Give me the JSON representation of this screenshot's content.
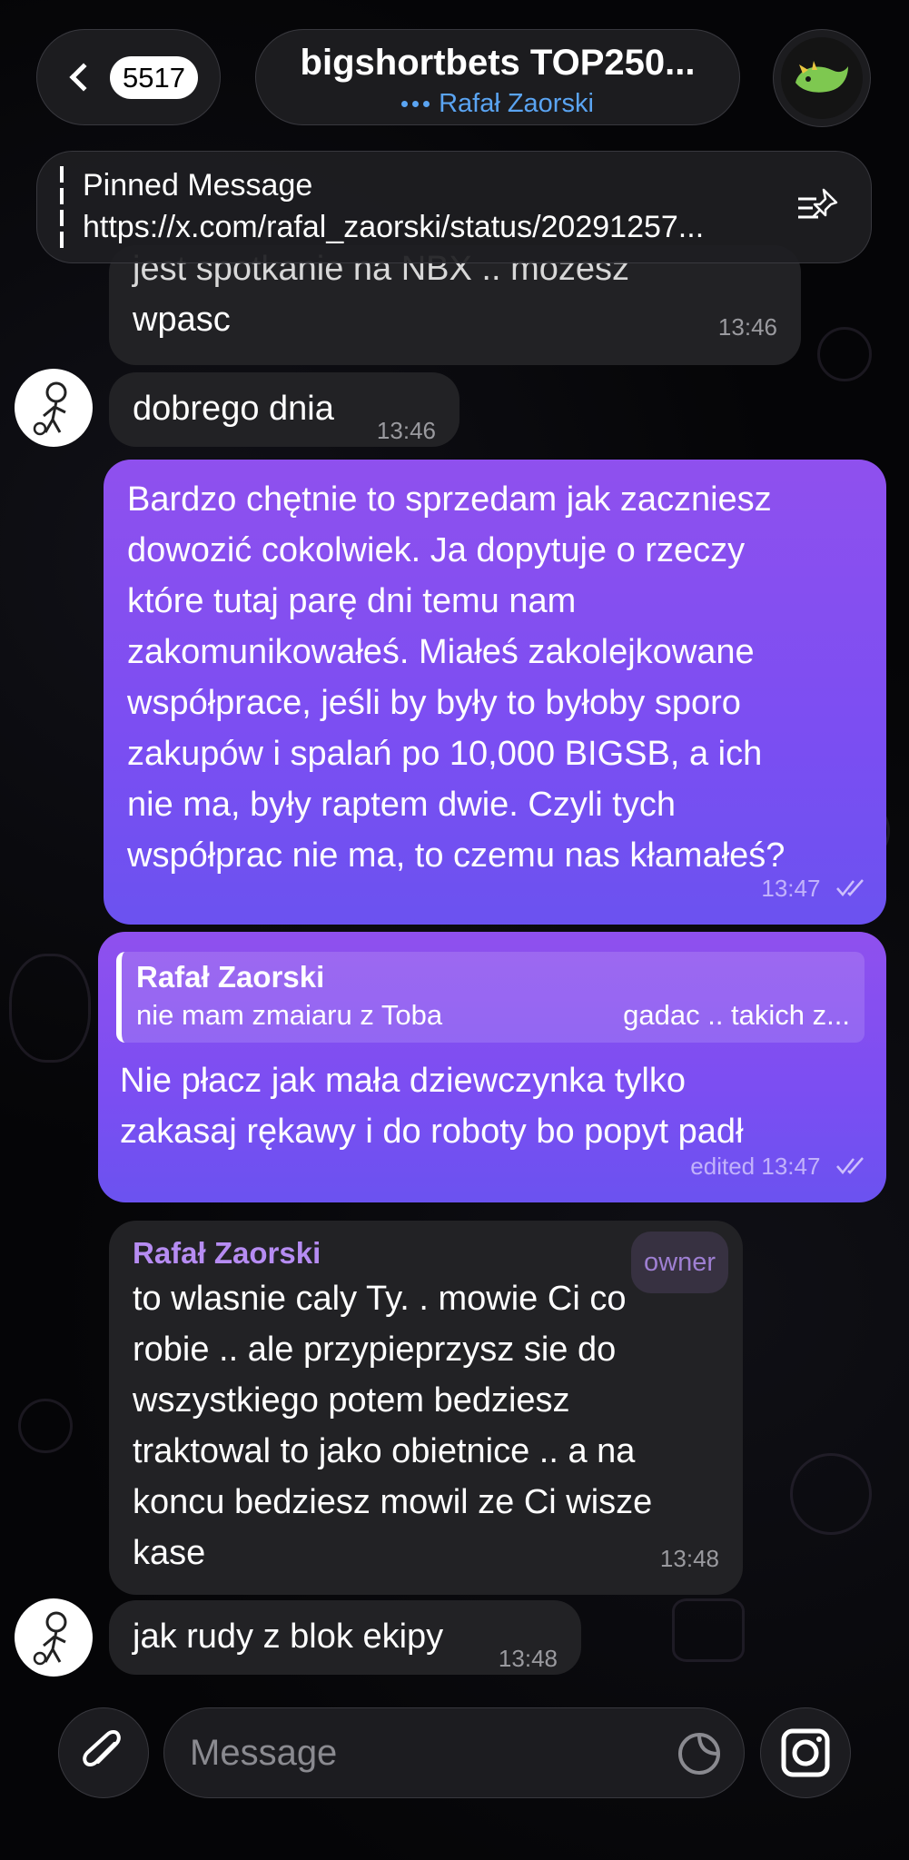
{
  "header": {
    "back_badge": "5517",
    "title": "bigshortbets TOP250...",
    "typing_user": "Rafał Zaorski"
  },
  "pinned": {
    "title": "Pinned Message",
    "text": "https://x.com/rafal_zaorski/status/20291257..."
  },
  "messages": [
    {
      "id": "m1",
      "direction": "in",
      "text_partial": "jest spotkanie na NBX .. mozesz",
      "text": "wpasc",
      "time": "13:46"
    },
    {
      "id": "m2",
      "direction": "in",
      "text": "dobrego dnia",
      "time": "13:46"
    },
    {
      "id": "m3",
      "direction": "out",
      "text": "Bardzo chętnie to sprzedam jak zaczniesz\ndowozić cokolwiek. Ja dopytuje o rzeczy\nktóre tutaj parę dni temu nam\nzakomunikowałeś. Miałeś zakolejkowane\nwspółprace, jeśli by były to byłoby sporo\nzakupów i spalań po 10,000 BIGSB, a ich\nnie ma, były raptem dwie. Czyli tych\nwspółprac nie ma, to czemu nas kłamałeś?",
      "time": "13:47"
    },
    {
      "id": "m4",
      "direction": "out",
      "reply_name": "Rafał Zaorski",
      "reply_text_left": "nie mam zmaiaru z Toba",
      "reply_text_right": "gadac .. takich z...",
      "text": "Nie płacz jak mała dziewczynka tylko\nzakasaj rękawy i do roboty bo popyt padł",
      "time": "edited 13:47"
    },
    {
      "id": "m5",
      "direction": "in",
      "sender": "Rafał Zaorski",
      "role": "owner",
      "text": "to wlasnie caly Ty. . mowie Ci co\nrobie .. ale przypieprzysz sie do\nwszystkiego potem bedziesz\ntraktowal to jako obietnice .. a na\nkoncu bedziesz mowil ze Ci wisze\nkase",
      "time": "13:48"
    },
    {
      "id": "m6",
      "direction": "in",
      "text": "jak rudy z blok ekipy",
      "time": "13:48"
    }
  ],
  "composer": {
    "placeholder": "Message"
  },
  "colors": {
    "outgoing_bubble": "#7b4ef2",
    "incoming_bubble": "#222225",
    "link_blue": "#5aa4f2",
    "sender_name": "#b68cf2"
  },
  "icons": [
    "chevron-left-icon",
    "group-avatar-icon",
    "pin-list-icon",
    "read-checks-icon",
    "attach-icon",
    "sticker-icon",
    "camera-icon"
  ]
}
